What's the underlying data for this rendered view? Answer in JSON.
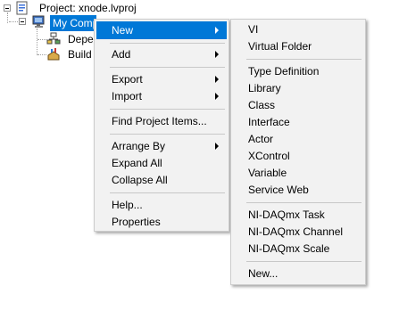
{
  "tree": {
    "project_label": "Project: xnode.lvproj",
    "computer_label": "My Computer",
    "dependencies_label": "Dependencies",
    "build_label": "Build Specifications"
  },
  "context_menu": {
    "items": {
      "new": "New",
      "add": "Add",
      "export": "Export",
      "import": "Import",
      "find_project_items": "Find Project Items...",
      "arrange_by": "Arrange By",
      "expand_all": "Expand All",
      "collapse_all": "Collapse All",
      "help": "Help...",
      "properties": "Properties"
    }
  },
  "new_submenu": {
    "items": {
      "vi": "VI",
      "virtual_folder": "Virtual Folder",
      "type_definition": "Type Definition",
      "library": "Library",
      "class": "Class",
      "interface": "Interface",
      "actor": "Actor",
      "xcontrol": "XControl",
      "variable": "Variable",
      "service_web": "Service Web",
      "daqmx_task": "NI-DAQmx Task",
      "daqmx_channel": "NI-DAQmx Channel",
      "daqmx_scale": "NI-DAQmx Scale",
      "new_ellipsis": "New..."
    }
  },
  "colors": {
    "highlight": "#0078d7",
    "menu_background": "#f2f2f2"
  },
  "icons": [
    "project-icon",
    "computer-icon",
    "dependencies-icon",
    "build-specifications-icon"
  ]
}
